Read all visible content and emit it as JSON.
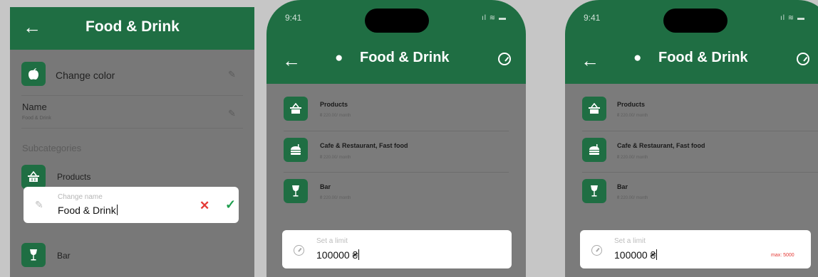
{
  "screen1": {
    "title": "Food & Drink",
    "change_color_label": "Change color",
    "name_label": "Name",
    "name_value": "Food & Drink",
    "subcategories_title": "Subcategories",
    "items": [
      {
        "label": "Products"
      },
      {
        "label": "Bar"
      }
    ],
    "edit": {
      "placeholder": "Change name",
      "value": "Food & Drink"
    }
  },
  "screen2": {
    "time": "9:41",
    "title": "Food & Drink",
    "categories": [
      {
        "title": "Products",
        "sub": "₴ 220.00/ month"
      },
      {
        "title": "Cafe & Restaurant, Fast food",
        "sub": "₴ 220.00/ month"
      },
      {
        "title": "Bar",
        "sub": "₴ 220.00/ month"
      }
    ],
    "limit": {
      "placeholder": "Set a limit",
      "value": "100000 ₴"
    }
  },
  "screen3": {
    "time": "9:41",
    "title": "Food & Drink",
    "categories": [
      {
        "title": "Products",
        "sub": "₴ 220.00/ month"
      },
      {
        "title": "Cafe & Restaurant, Fast food",
        "sub": "₴ 220.00/ month"
      },
      {
        "title": "Bar",
        "sub": "₴ 220.00/ month"
      }
    ],
    "limit": {
      "placeholder": "Set a limit",
      "value": "100000 ₴",
      "max_note": "max: 5000"
    }
  },
  "colors": {
    "brand_green": "#1f6e43",
    "confirm": "#1e9e4e",
    "cancel": "#e53935"
  },
  "icons": [
    "back-arrow-icon",
    "apple-icon",
    "basket-icon",
    "burger-icon",
    "wine-glass-icon",
    "pencil-icon",
    "gauge-icon",
    "close-icon",
    "check-icon",
    "signal-icon",
    "wifi-icon",
    "battery-icon"
  ]
}
